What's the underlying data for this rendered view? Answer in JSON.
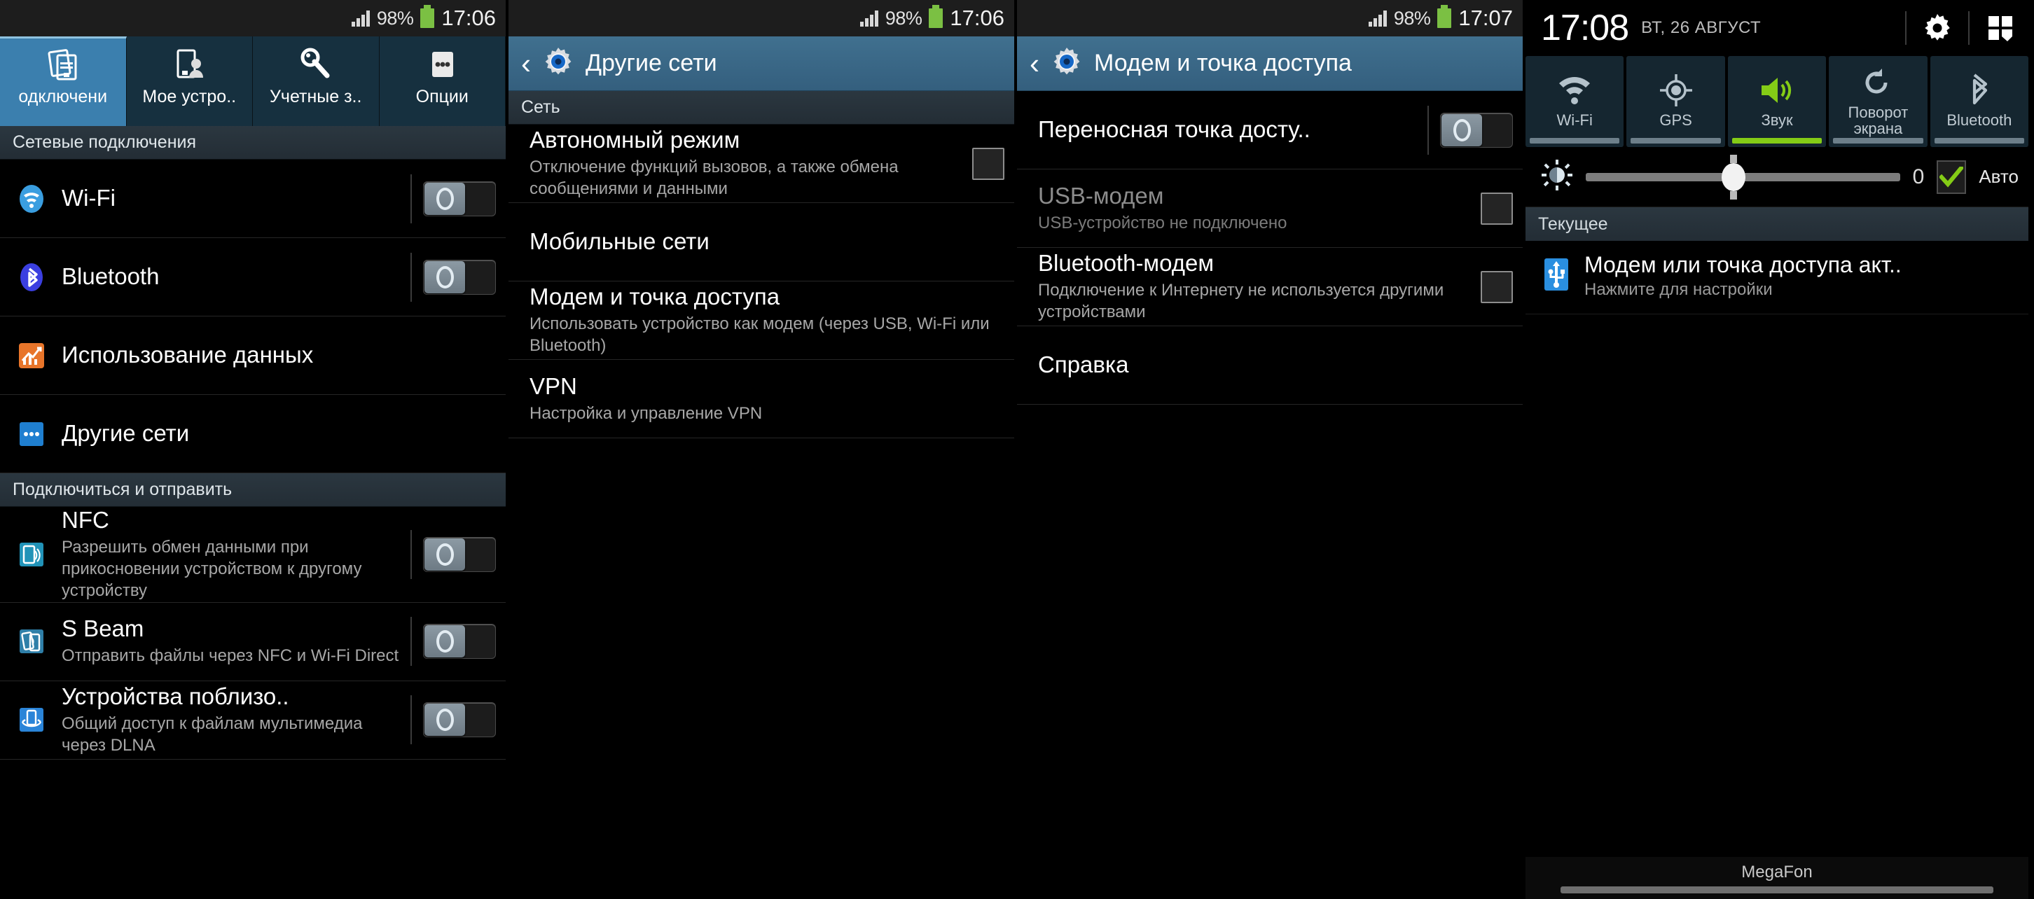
{
  "status_bar": {
    "battery_percent": "98%",
    "time_p1": "17:06",
    "time_p2": "17:06",
    "time_p3": "17:07"
  },
  "panel1": {
    "tabs": [
      {
        "label": "одключени",
        "icon": "connections-icon",
        "active": true
      },
      {
        "label": "Мое устро..",
        "icon": "my-device-icon",
        "active": false
      },
      {
        "label": "Учетные з..",
        "icon": "accounts-icon",
        "active": false
      },
      {
        "label": "Опции",
        "icon": "more-options-icon",
        "active": false
      }
    ],
    "sections": [
      {
        "header": "Сетевые подключения",
        "rows": [
          {
            "title": "Wi-Fi",
            "sub": "",
            "icon": "wifi-icon",
            "control": "toggle"
          },
          {
            "title": "Bluetooth",
            "sub": "",
            "icon": "bluetooth-icon",
            "control": "toggle"
          },
          {
            "title": "Использование данных",
            "sub": "",
            "icon": "data-usage-icon",
            "control": "none"
          },
          {
            "title": "Другие сети",
            "sub": "",
            "icon": "more-networks-icon",
            "control": "none"
          }
        ]
      },
      {
        "header": "Подключиться и отправить",
        "rows": [
          {
            "title": "NFC",
            "sub": "Разрешить обмен данными при прикосновении устройством к другому устройству",
            "icon": "nfc-icon",
            "control": "toggle"
          },
          {
            "title": "S Beam",
            "sub": "Отправить файлы через NFC и Wi-Fi Direct",
            "icon": "s-beam-icon",
            "control": "toggle"
          },
          {
            "title": "Устройства поблизо..",
            "sub": "Общий доступ к файлам мультимедиа через DLNA",
            "icon": "nearby-devices-icon",
            "control": "toggle"
          }
        ]
      }
    ]
  },
  "panel2": {
    "title": "Другие сети",
    "section_header": "Сеть",
    "rows": [
      {
        "title": "Автономный режим",
        "sub": "Отключение функций вызовов, а также обмена сообщениями и данными",
        "control": "checkbox"
      },
      {
        "title": "Мобильные сети",
        "sub": "",
        "control": "none"
      },
      {
        "title": "Модем и точка доступа",
        "sub": "Использовать устройство как модем (через USB, Wi-Fi или Bluetooth)",
        "control": "none"
      },
      {
        "title": "VPN",
        "sub": "Настройка и управление VPN",
        "control": "none"
      }
    ]
  },
  "panel3": {
    "title": "Модем и точка доступа",
    "rows": [
      {
        "title": "Переносная точка досту..",
        "sub": "",
        "control": "toggle",
        "dim": false
      },
      {
        "title": "USB-модем",
        "sub": "USB-устройство не подключено",
        "control": "checkbox",
        "dim": true
      },
      {
        "title": "Bluetooth-модем",
        "sub": "Подключение к Интернету не используется другими устройствами",
        "control": "checkbox",
        "dim": false
      },
      {
        "title": "Справка",
        "sub": "",
        "control": "none",
        "dim": false
      }
    ]
  },
  "panel4": {
    "clock": "17:08",
    "date": "ВТ, 26 АВГУСТ",
    "quick_tiles": [
      {
        "label": "Wi-Fi",
        "icon": "wifi-icon",
        "on": false
      },
      {
        "label": "GPS",
        "icon": "gps-icon",
        "on": false
      },
      {
        "label": "Звук",
        "icon": "sound-icon",
        "on": true
      },
      {
        "label": "Поворот экрана",
        "icon": "rotate-screen-icon",
        "on": false
      },
      {
        "label": "Bluetooth",
        "icon": "bluetooth-icon",
        "on": false
      }
    ],
    "brightness": {
      "value": "0",
      "auto_label": "Авто",
      "auto_checked": true
    },
    "notifications_header": "Текущее",
    "notifications": [
      {
        "title": "Модем или точка доступа акт..",
        "sub": "Нажмите для настройки",
        "icon": "usb-tether-icon"
      }
    ],
    "carrier": "MegaFon"
  },
  "colors": {
    "accent_blue": "#3b7fae",
    "action_bar": "#3a6b8d",
    "green": "#84cc16",
    "section_bg": "#2b3740"
  }
}
